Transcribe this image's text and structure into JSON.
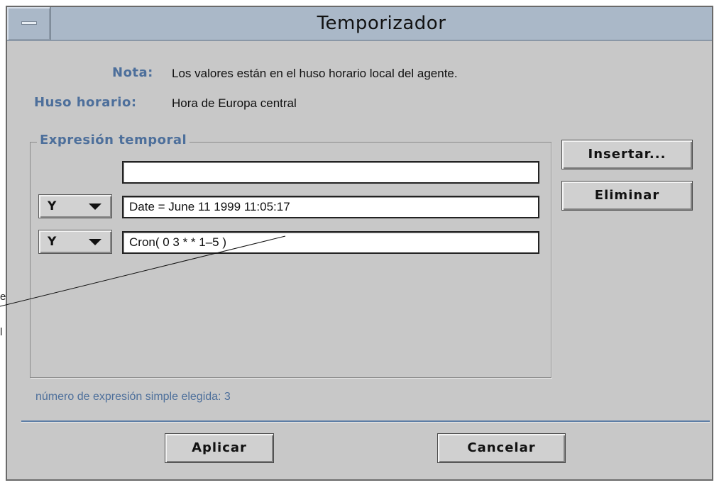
{
  "window": {
    "title": "Temporizador"
  },
  "info": {
    "note_label": "Nota:",
    "note_value": "Los valores están en el huso horario local del agente.",
    "timezone_label": "Huso horario:",
    "timezone_value": "Hora de Europa central"
  },
  "group": {
    "title": "Expresión temporal",
    "rows": [
      {
        "operator": "",
        "value": ""
      },
      {
        "operator": "Y",
        "value": "Date = June 11 1999 11:05:17"
      },
      {
        "operator": "Y",
        "value": "Cron( 0 3 * * 1–5 )"
      }
    ]
  },
  "side_buttons": {
    "insert": "Insertar...",
    "delete": "Eliminar"
  },
  "status": "número de expresión simple elegida: 3",
  "footer_buttons": {
    "apply": "Aplicar",
    "cancel": "Cancelar"
  },
  "outside_fragments": [
    "e",
    "l"
  ],
  "colors": {
    "title_bar": "#aab8c8",
    "label_blue": "#4d6f9b",
    "window_bg": "#c8c8c8"
  }
}
